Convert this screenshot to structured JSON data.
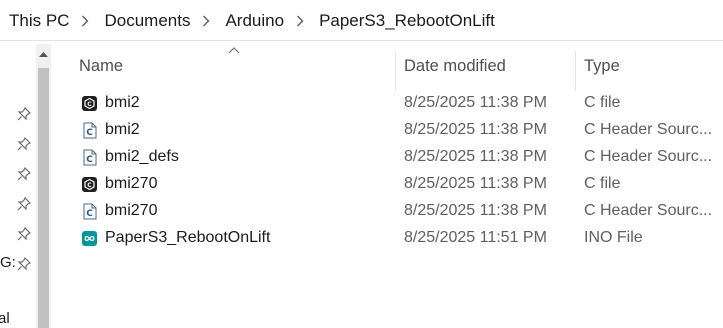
{
  "breadcrumb": [
    "This PC",
    "Documents",
    "Arduino",
    "PaperS3_RebootOnLift"
  ],
  "columns": {
    "name": "Name",
    "date": "Date modified",
    "type": "Type"
  },
  "nav_fragments": [
    "G:",
    "al"
  ],
  "files": [
    {
      "name": "bmi2",
      "date": "8/25/2025 11:38 PM",
      "type": "C file",
      "icon": "c-file-icon"
    },
    {
      "name": "bmi2",
      "date": "8/25/2025 11:38 PM",
      "type": "C Header Sourc...",
      "icon": "c-header-file-icon"
    },
    {
      "name": "bmi2_defs",
      "date": "8/25/2025 11:38 PM",
      "type": "C Header Sourc...",
      "icon": "c-header-file-icon"
    },
    {
      "name": "bmi270",
      "date": "8/25/2025 11:38 PM",
      "type": "C file",
      "icon": "c-file-icon"
    },
    {
      "name": "bmi270",
      "date": "8/25/2025 11:38 PM",
      "type": "C Header Sourc...",
      "icon": "c-header-file-icon"
    },
    {
      "name": "PaperS3_RebootOnLift",
      "date": "8/25/2025 11:51 PM",
      "type": "INO File",
      "icon": "arduino-file-icon"
    }
  ]
}
